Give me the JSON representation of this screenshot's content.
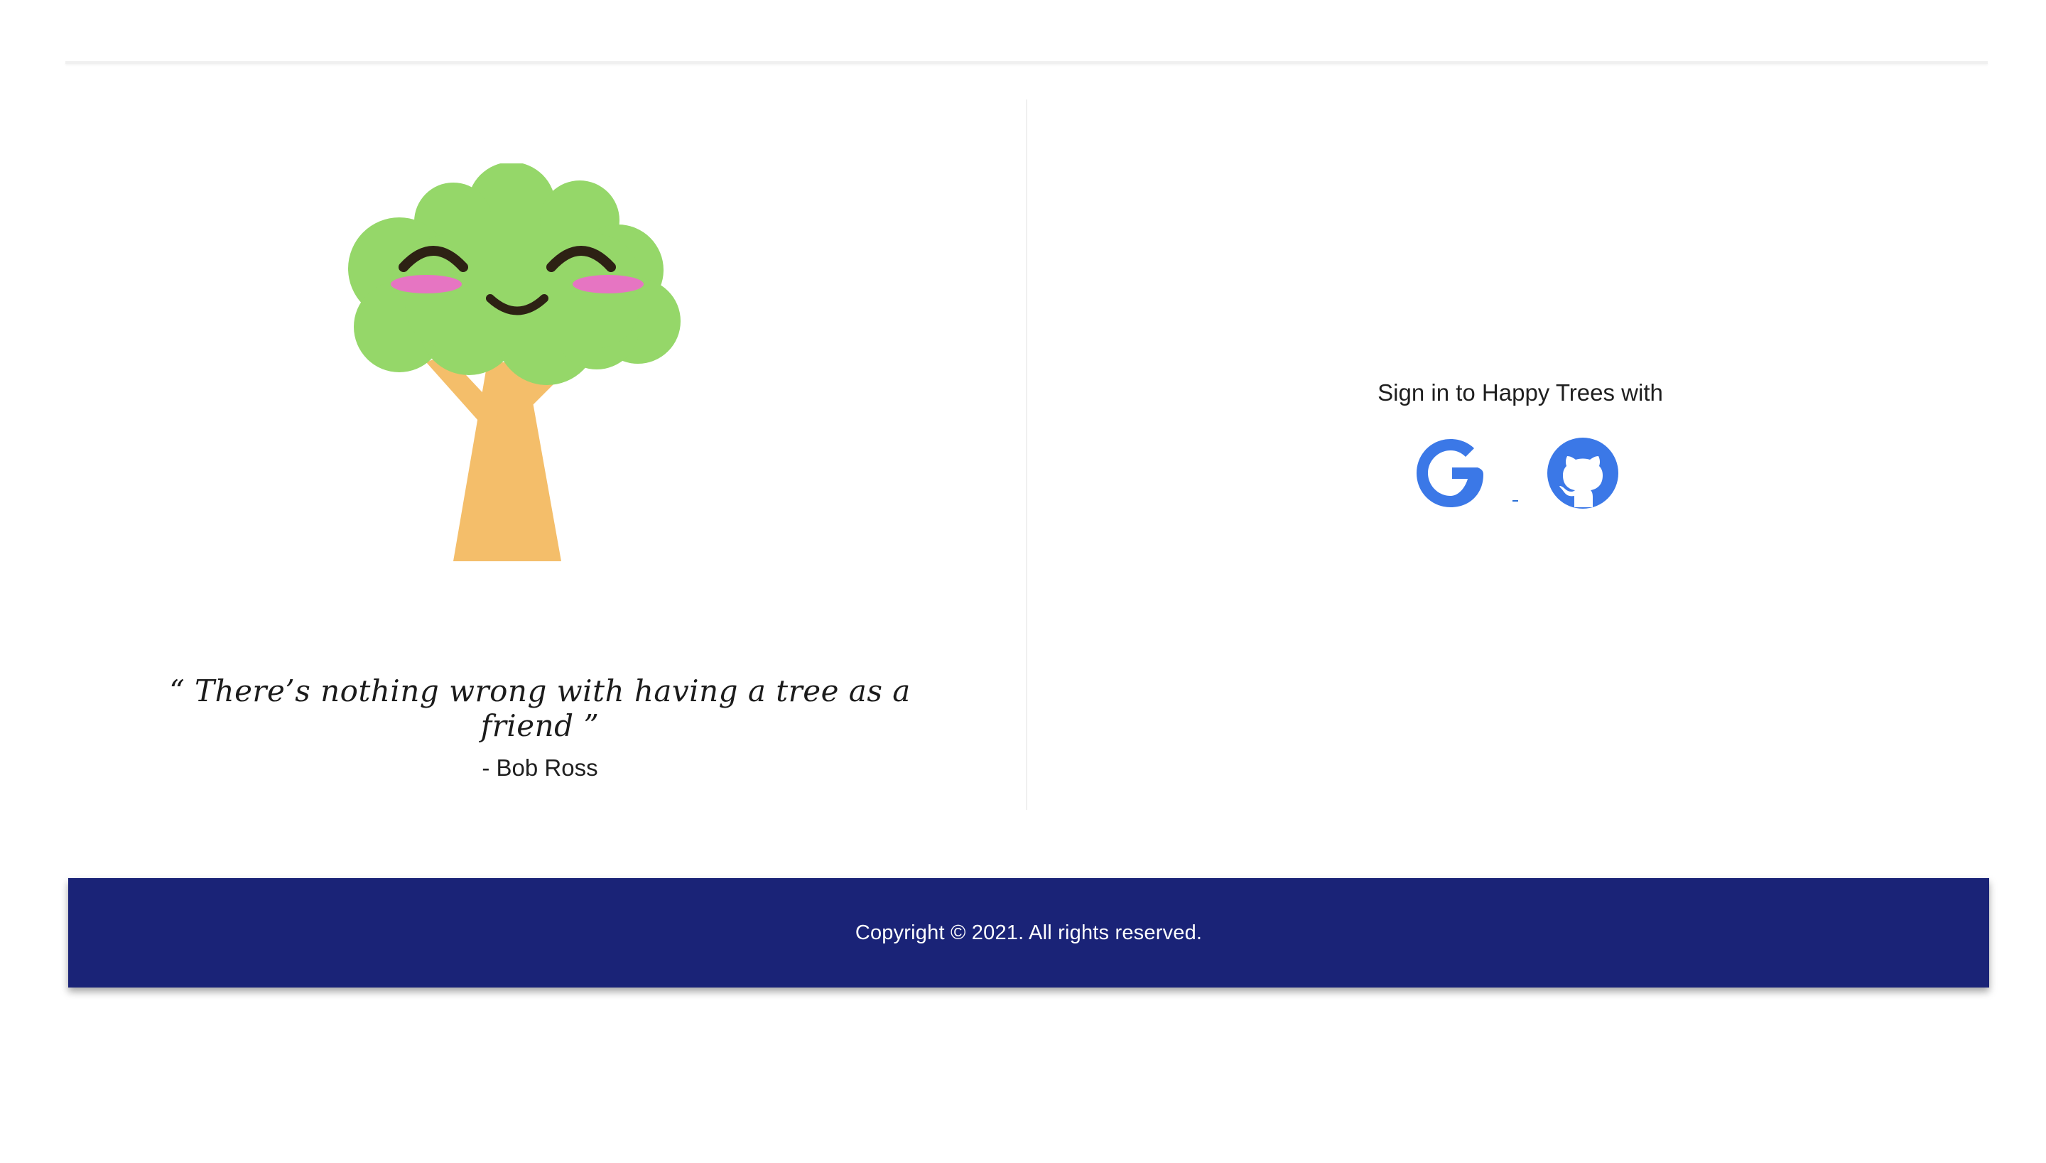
{
  "quote": {
    "text": "“ There’s nothing wrong with having a tree as a friend ”",
    "author": "- Bob Ross"
  },
  "signin": {
    "title": "Sign in to Happy Trees with",
    "providers": [
      {
        "name": "Google",
        "icon": "google-icon",
        "color": "#3b78e7"
      },
      {
        "name": "GitHub",
        "icon": "github-icon",
        "color": "#3b78e7"
      }
    ]
  },
  "footer": {
    "copyright": "Copyright © 2021. All rights reserved.",
    "background": "#1a2377"
  },
  "colors": {
    "tree_foliage": "#95d769",
    "tree_trunk": "#f4be6a",
    "cheek": "#e675c2",
    "face": "#2d2114"
  }
}
